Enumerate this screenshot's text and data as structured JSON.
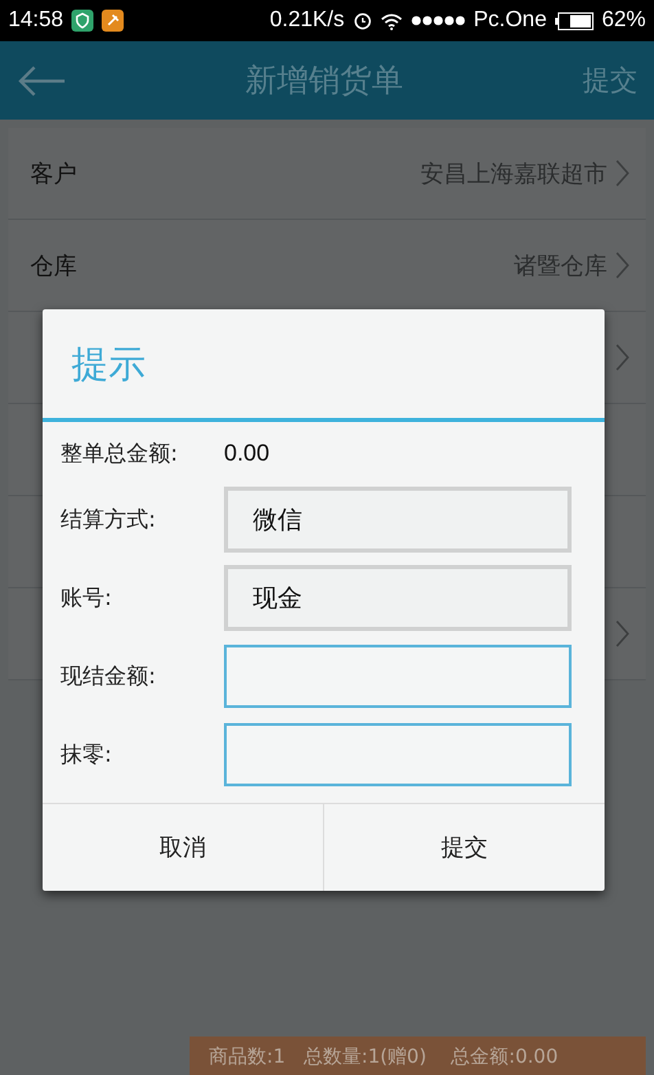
{
  "status_bar": {
    "time": "14:58",
    "speed": "0.21K/s",
    "carrier": "Pc.One",
    "battery": "62%"
  },
  "app_bar": {
    "title": "新增销货单",
    "action": "提交"
  },
  "form_rows": [
    {
      "label": "客户",
      "value": "安昌上海嘉联超市",
      "chevron": true
    },
    {
      "label": "仓库",
      "value": "诸暨仓库",
      "chevron": true
    },
    {
      "chevron": true
    },
    {
      "chevron": false
    },
    {
      "chevron": false
    },
    {
      "chevron": true
    }
  ],
  "summary_bar": {
    "text": "商品数:1   总数量:1(赠0)    总金额:0.00"
  },
  "dialog": {
    "title": "提示",
    "fields": [
      {
        "kind": "text",
        "label": "整单总金额:",
        "value": "0.00"
      },
      {
        "kind": "select",
        "label": "结算方式:",
        "value": "微信"
      },
      {
        "kind": "select",
        "label": "账号:",
        "value": "现金"
      },
      {
        "kind": "input",
        "label": "现结金额:"
      },
      {
        "kind": "input",
        "label": "抹零:"
      }
    ],
    "buttons": [
      "取消",
      "提交"
    ]
  }
}
